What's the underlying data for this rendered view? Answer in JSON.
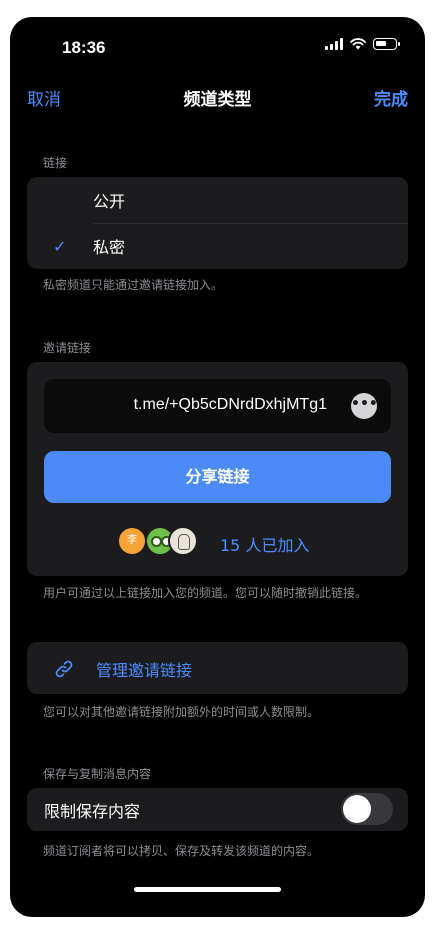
{
  "status_bar": {
    "time": "18:36"
  },
  "nav": {
    "cancel": "取消",
    "title": "频道类型",
    "done": "完成"
  },
  "link_type": {
    "header": "链接",
    "options": [
      {
        "label": "公开",
        "selected": false
      },
      {
        "label": "私密",
        "selected": true
      }
    ],
    "check_mark": "✓",
    "footnote": "私密频道只能通过邀请链接加入。"
  },
  "invite": {
    "header": "邀请链接",
    "link": "t.me/+Qb5cDNrdDxhjMTg1",
    "more_glyph": "•••",
    "share_button": "分享链接",
    "avatar_initial": "李",
    "joined": "15 人已加入",
    "footnote": "用户可通过以上链接加入您的频道。您可以随时撤销此链接。"
  },
  "manage": {
    "label": "管理邀请链接",
    "footnote": "您可以对其他邀请链接附加额外的时间或人数限制。"
  },
  "save_copy": {
    "header": "保存与复制消息内容",
    "restrict_label": "限制保存内容",
    "toggle_on": false,
    "footnote": "频道订阅者将可以拷贝、保存及转发该频道的内容。"
  },
  "colors": {
    "accent": "#4a8dff",
    "button": "#4c8bf5",
    "card": "#1c1c1e",
    "background": "#000000"
  }
}
